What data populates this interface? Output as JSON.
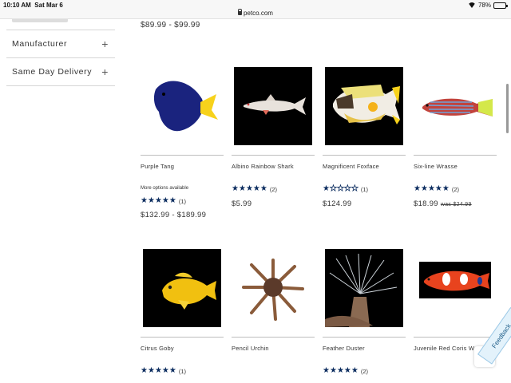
{
  "status_bar": {
    "time": "10:10 AM",
    "date": "Sat Mar 6",
    "url": "petco.com",
    "battery": "78%",
    "battery_level": 0.78
  },
  "sidebar": {
    "items": [
      {
        "label": "Manufacturer",
        "icon": "plus-icon"
      },
      {
        "label": "Same Day Delivery",
        "icon": "plus-icon"
      }
    ]
  },
  "top_price": "$89.99 - $99.99",
  "products": [
    {
      "name": "Purple Tang",
      "options": "More options available",
      "rating": 5,
      "reviews": "(1)",
      "price": "$132.99 - $189.99",
      "was": ""
    },
    {
      "name": "Albino Rainbow Shark",
      "options": "",
      "rating": 5,
      "reviews": "(2)",
      "price": "$5.99",
      "was": ""
    },
    {
      "name": "Magnificent Foxface",
      "options": "",
      "rating": 1,
      "reviews": "(1)",
      "price": "$124.99",
      "was": ""
    },
    {
      "name": "Six-line Wrasse",
      "options": "",
      "rating": 5,
      "reviews": "(2)",
      "price": "$18.99",
      "was": "was $24.99"
    },
    {
      "name": "Citrus Goby",
      "options": "",
      "rating": 5,
      "reviews": "(1)",
      "price": "",
      "was": ""
    },
    {
      "name": "Pencil Urchin",
      "options": "",
      "rating": 0,
      "reviews": "",
      "price": "",
      "was": ""
    },
    {
      "name": "Feather Duster",
      "options": "",
      "rating": 5,
      "reviews": "(2)",
      "price": "",
      "was": ""
    },
    {
      "name": "Juvenile Red Coris W",
      "options": "",
      "rating": 0,
      "reviews": "",
      "price": "",
      "was": ""
    }
  ],
  "feedback_label": "Feedback",
  "icons": {
    "scroll_up": "chevron-up-icon",
    "star": "star-icon"
  },
  "colors": {
    "star": "#0b2c5f",
    "feedback_bg": "#e3f2fb"
  }
}
